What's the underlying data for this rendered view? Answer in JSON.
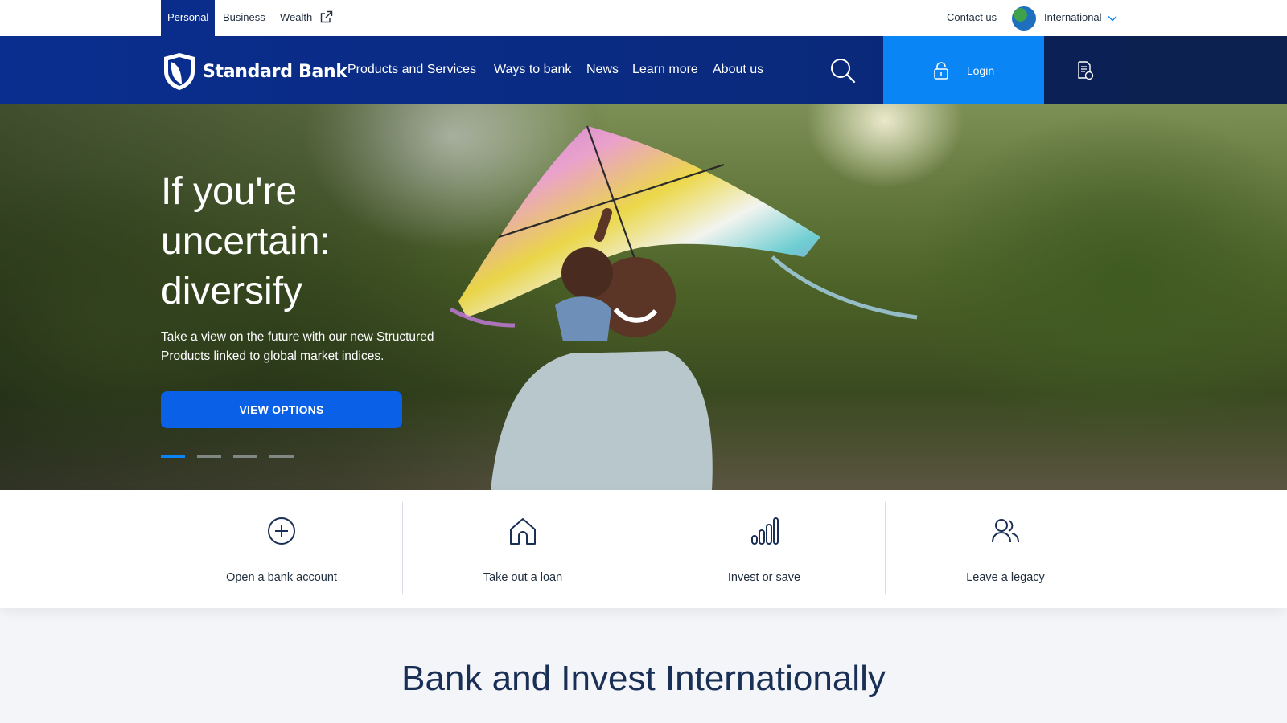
{
  "utility_bar": {
    "segments": [
      {
        "label": "Personal",
        "active": true
      },
      {
        "label": "Business",
        "active": false
      },
      {
        "label": "Wealth",
        "active": false
      }
    ],
    "contact_label": "Contact us",
    "region_label": "International"
  },
  "header": {
    "brand": "Standard Bank",
    "nav": [
      "Products and Services",
      "Ways to bank",
      "News",
      "Learn more",
      "About us"
    ],
    "login_label": "Login"
  },
  "hero": {
    "title_lines": [
      "If you're",
      "uncertain:",
      "diversify"
    ],
    "subtitle": "Take a view on the future with our new Structured Products linked to global market indices.",
    "cta_label": "VIEW OPTIONS",
    "slides": 4,
    "active_slide": 1
  },
  "quick_actions": [
    {
      "label": "Open a bank account",
      "icon": "plus-circle-icon"
    },
    {
      "label": "Take out a loan",
      "icon": "home-icon"
    },
    {
      "label": "Invest or save",
      "icon": "bar-chart-icon"
    },
    {
      "label": "Leave a legacy",
      "icon": "people-icon"
    }
  ],
  "section": {
    "title": "Bank and Invest Internationally"
  },
  "colors": {
    "navy": "#0a2c8a",
    "login_blue": "#0a85f5",
    "cta_blue": "#0a61e8",
    "heading_navy": "#1a2f55"
  }
}
